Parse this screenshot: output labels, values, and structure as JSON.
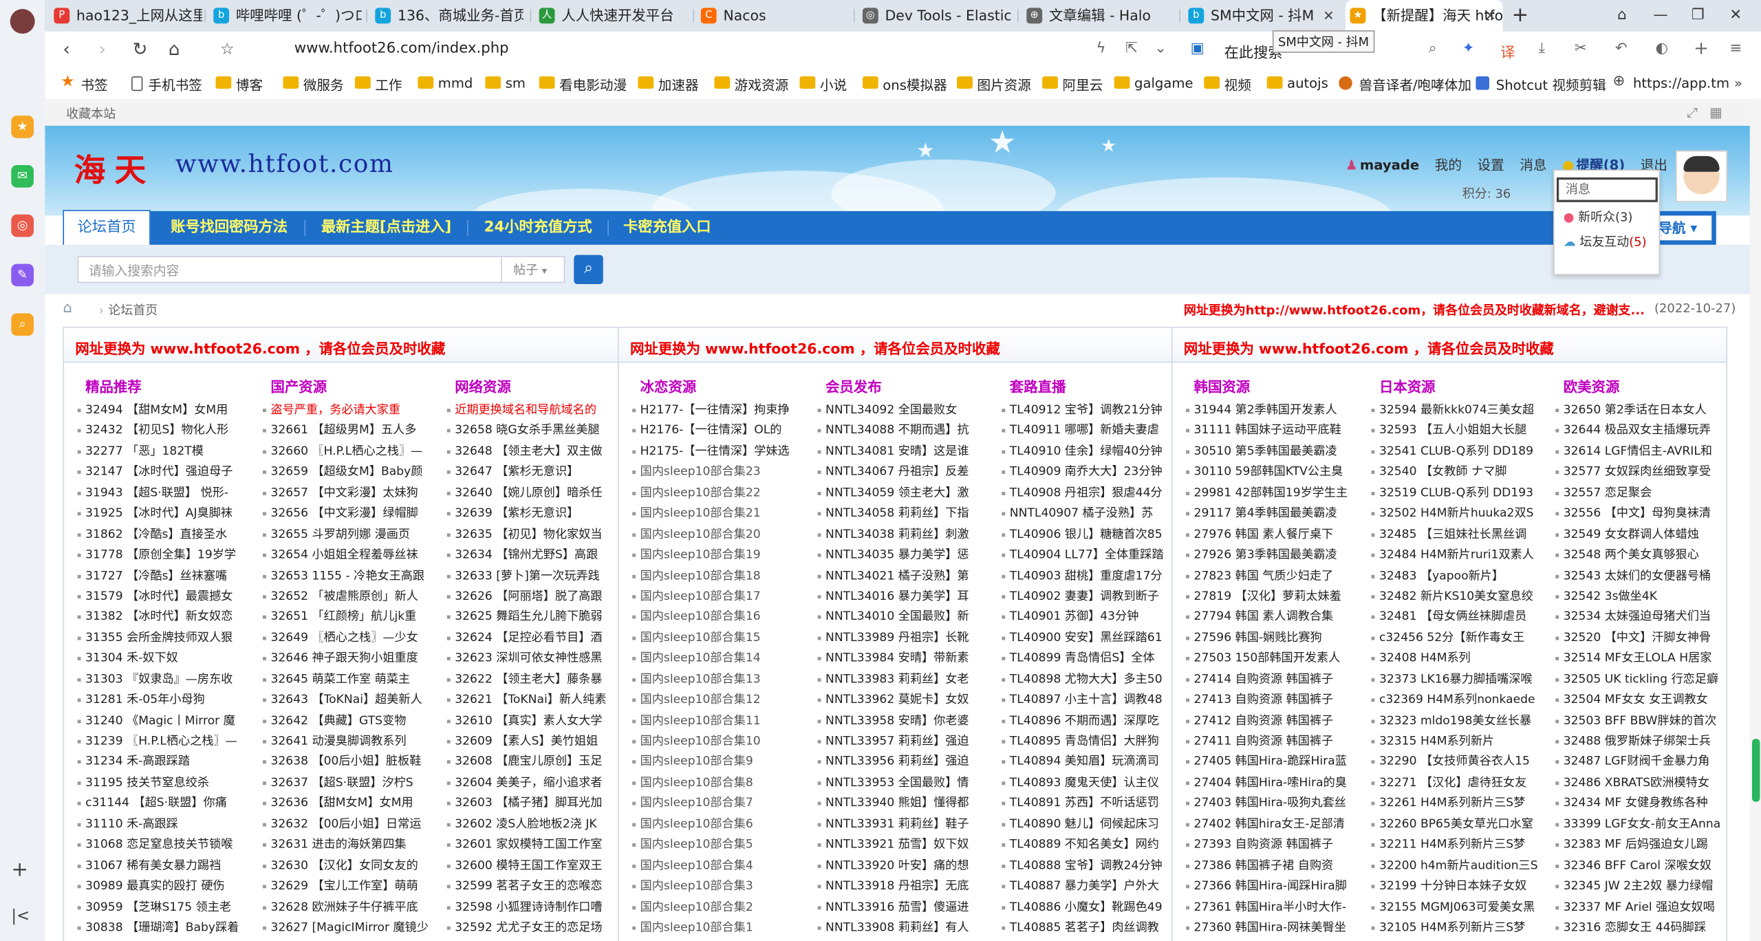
{
  "browser": {
    "tabs": [
      {
        "label": "hao123_上网从这里",
        "icon": "P",
        "color": "#e53935"
      },
      {
        "label": "哔哩哔哩 (゜-゜)つロ",
        "icon": "b",
        "color": "#13a4de"
      },
      {
        "label": "136、商城业务-首页",
        "icon": "b",
        "color": "#13a4de"
      },
      {
        "label": "人人快速开发平台",
        "icon": "人",
        "color": "#2b9a3f"
      },
      {
        "label": "Nacos",
        "icon": "C",
        "color": "#ff6a00"
      },
      {
        "label": "Dev Tools - Elastic",
        "icon": "◎",
        "color": "#555"
      },
      {
        "label": "文章编辑 - Halo",
        "icon": "⊕",
        "color": "#555"
      },
      {
        "label": "SM中文网 - 抖M",
        "icon": "b",
        "color": "#13a4de"
      },
      {
        "label": "【新提醒】海天 htfo",
        "icon": "★",
        "color": "#f0a000"
      }
    ],
    "new_tab_label": "+",
    "url": "www.htfoot26.com/index.php",
    "tooltip": "SM中文网 - 抖M",
    "search_placeholder": "在此搜索",
    "bookmarks": [
      {
        "label": "书签",
        "type": "star"
      },
      {
        "label": "手机书签",
        "type": "doc"
      },
      {
        "label": "博客",
        "type": "folder"
      },
      {
        "label": "微服务",
        "type": "folder"
      },
      {
        "label": "工作",
        "type": "folder"
      },
      {
        "label": "mmd",
        "type": "folder"
      },
      {
        "label": "sm",
        "type": "folder"
      },
      {
        "label": "看电影动漫",
        "type": "folder"
      },
      {
        "label": "加速器",
        "type": "folder"
      },
      {
        "label": "游戏资源",
        "type": "folder"
      },
      {
        "label": "小说",
        "type": "folder"
      },
      {
        "label": "ons模拟器",
        "type": "folder"
      },
      {
        "label": "图片资源",
        "type": "folder"
      },
      {
        "label": "阿里云",
        "type": "folder"
      },
      {
        "label": "galgame",
        "type": "folder"
      },
      {
        "label": "视频",
        "type": "folder"
      },
      {
        "label": "autojs",
        "type": "folder"
      },
      {
        "label": "兽音译者/咆哮体加",
        "type": "ico"
      },
      {
        "label": "Shotcut 视频剪辑",
        "type": "ico"
      },
      {
        "label": "https://app.tm",
        "type": "glob"
      }
    ]
  },
  "site": {
    "collect_label": "收藏本站",
    "logo_cn": "海天",
    "logo_en": "www.htfoot.com",
    "user": {
      "name": "mayade",
      "mine": "我的",
      "settings": "设置",
      "messages": "消息",
      "remind": "提醒(8)",
      "logout": "退出",
      "points": "积分: 36"
    },
    "notif": {
      "msg": "消息",
      "listen": "新听众",
      "listen_count": "(3)",
      "interact": "坛友互动",
      "interact_count": "(5)"
    },
    "nav": {
      "items": [
        "论坛首页",
        "账号找回密码方法",
        "最新主题[点击进入]",
        "24小时充值方式",
        "卡密充值入口"
      ],
      "right": "导航"
    },
    "search": {
      "placeholder": "请输入搜索内容",
      "scope": "帖子"
    },
    "breadcrumb": "论坛首页",
    "announce": "网址更换为http://www.htfoot26.com，请各位会员及时收藏新域名，避谢支...",
    "announce_date": "(2022-10-27)"
  },
  "columns": [
    {
      "header": "网址更换为 www.htfoot26.com ，请各位会员及时收藏",
      "subs": [
        {
          "title": "精品推荐",
          "title_red": false,
          "items": [
            "32494 【甜M女M】女M用",
            "32432 【初见S】物化人形",
            "32277 「恶」182T模",
            "32147 【冰时代】强迫母子",
            "31943 【超S·联盟】 悦形-",
            "31925 【冰时代】AJ臭脚袜",
            "31862 【冷酷s】直接圣水",
            "31778 【原创全集】19岁学",
            "31727 【冷酷s】丝袜塞嘴",
            "31579 【冰时代】最震撼女",
            "31382 【冰时代】新女奴恋",
            "31355 会所金牌技师双人狠",
            "31304 禾-奴下奴",
            "31303 『奴隶岛』—房东收",
            "31281 禾-05年小母狗",
            "31240 《Magic丨Mirror 魔",
            "31239 〖H.P.L栖心之栈〗—",
            "31234 禾-高跟踩踏",
            "31195 技关节窒息绞杀",
            "c31144 【超S·联盟】你痛",
            "31110 禾-高跟踩",
            "31068 恋足窒息技关节锁喉",
            "31067 稀有美女暴力踢裆",
            "30989 最真实的殴打 硬伤",
            "30959 【芝琳S175 领主老",
            "30838 【珊瑚湾】Baby踩着"
          ]
        },
        {
          "title": "国产资源",
          "title_red": false,
          "items": [
            "盗号严重，务必请大家重",
            "32661 【超级男M】五人多",
            "32660 〖H.P.L栖心之栈〗—",
            "32659 【超级女M】Baby颜",
            "32657 【中文彩漫】太妹狗",
            "32656 【中文彩漫】绿帽脚",
            "32655 斗罗胡列娜 漫画页",
            "32654 小姐姐全程羞辱丝袜",
            "32653 1155 - 冷艳女王高跟",
            "32652 「被虐熊原创」新人",
            "32651 「红颜榜」航儿jk重",
            "32649 〖栖心之栈〗—少女",
            "32646 神子跟天狗小姐重度",
            "32645 萌菜工作室 萌菜主",
            "32643 【ToKNai】超美新人",
            "32642 【典藏】GTS变物",
            "32641 动漫臭脚调教系列",
            "32638 【00后小姐】脏板鞋",
            "32637 【超S·联盟】汐柠S",
            "32636 【甜M女M】女M用",
            "32632 【00后小姐】日常运",
            "32631 进击的海妖第四集",
            "32630 【汉化】女同女友的",
            "32629 【宝儿工作室】萌萌",
            "32628 欧洲妹子牛仔裤平底",
            "32627 [MagicIMirror 魔镜少"
          ]
        },
        {
          "title": "网络资源",
          "title_red": false,
          "items": [
            "近期更换域名和导航域名的",
            "32658 晓G女杀手黑丝美腿",
            "32648 【领主老大】双主做",
            "32647 【紫杉无意识】",
            "32640 【婉儿原创】暗杀任",
            "32639 【紫杉无意识】",
            "32635 【初见】物化家奴当",
            "32634 【锦州尤野S】高跟",
            "32633 [萝卜]第一次玩弄践",
            "32626 【阿丽塔】脱了高跟",
            "32625 舞蹈生允儿胯下脆弱",
            "32624 【足控必看节目】酒",
            "32623 深圳可依女神性感黑",
            "32622 【领主老大】藤条暴",
            "32621 【ToKNai】新人纯素",
            "32610 【真实】素人女大学",
            "32609 【素人S】美竹姐姐",
            "32608 【鹿宝儿原创】玉足",
            "32604 美美子，缩小追求者",
            "32603 【橘子猪】脚耳光加",
            "32602 凌S人脸地板2浇 JK",
            "32601 家奴模特工国工作室",
            "32600 模特王国工作室双王",
            "32599 茗茗子女王的恋喉恋",
            "32598 小狐狸诗诗制作口嘈",
            "32592 尤尤子女王的恋足场"
          ]
        }
      ]
    },
    {
      "header": "网址更换为 www.htfoot26.com ，请各位会员及时收藏",
      "subs": [
        {
          "title": "冰恋资源",
          "title_red": false,
          "items": [
            "H2177-【一往情深】拘束挣",
            "H2176-【一往情深】OL的",
            "H2175-【一往情深】学妹选",
            "国内sleep10部合集23",
            "国内sleep10部合集22",
            "国内sleep10部合集21",
            "国内sleep10部合集20",
            "国内sleep10部合集19",
            "国内sleep10部合集18",
            "国内sleep10部合集17",
            "国内sleep10部合集16",
            "国内sleep10部合集15",
            "国内sleep10部合集14",
            "国内sleep10部合集13",
            "国内sleep10部合集12",
            "国内sleep10部合集11",
            "国内sleep10部合集10",
            "国内sleep10部合集9",
            "国内sleep10部合集8",
            "国内sleep10部合集7",
            "国内sleep10部合集6",
            "国内sleep10部合集5",
            "国内sleep10部合集4",
            "国内sleep10部合集3",
            "国内sleep10部合集2",
            "国内sleep10部合集1"
          ]
        },
        {
          "title": "会员发布",
          "title_red": false,
          "items": [
            "NNTL34092 全国最败女",
            "NNTL34088 不期而遇】抗",
            "NNTL34081 安晴】这是谁",
            "NNTL34067 丹祖宗】反差",
            "NNTL34059 领主老大】激",
            "NNTL34058 莉莉丝】下指",
            "NNTL34038 莉莉丝】刺激",
            "NNTL34035 暴力美学】惩",
            "NNTL34021 橘子没熟】第",
            "NNTL34016 暴力美学】耳",
            "NNTL34010 全国最败】新",
            "NNTL33989 丹祖宗】长靴",
            "NNTL33984 安晴】带新素",
            "NNTL33983 莉莉丝】女老",
            "NNTL33962 莫妮卡】女奴",
            "NNTL33958 安晴】你老婆",
            "NNTL33957 莉莉丝】强迫",
            "NNTL33956 莉莉丝】强迫",
            "NNTL33953 全国最败】情",
            "NNTL33940 熊姐】懂得都",
            "NNTL33931 莉莉丝】鞋子",
            "NNTL33921 茄雪】奴下奴",
            "NNTL33920 叶安】痛的想",
            "NNTL33918 丹祖宗】无底",
            "NNTL33916 茄雪】傻逼进",
            "NNTL33908 莉莉丝】有人"
          ]
        },
        {
          "title": "套路直播",
          "title_red": false,
          "items": [
            "TL40912 宝爷】调教21分钟",
            "TL40911 哪哪】新婚夫妻虐",
            "TL40910 佳余】绿帽40分钟",
            "TL40909 南乔大大】23分钟",
            "TL40908 丹祖宗】狠虐44分",
            "NNTL40907 橘子没熟】苏",
            "TL40906 银儿】糖糖首次85",
            "TL40904 LL77】全体重踩踏",
            "TL40903 甜桃】重度虐17分",
            "TL40902 妻妻】调教到断子",
            "TL40901 苏御】43分钟",
            "TL40900 安安】黑丝踩踏61",
            "TL40899 青岛情侣S】全体",
            "TL40898 尤物大大】多主50",
            "TL40897 小主十言】调教48",
            "TL40896 不期而遇】深厚吃",
            "TL40895 青岛情侣】大胖狗",
            "TL40894 美知眉】玩滴滴司",
            "TL40893 魔鬼天使】认主仪",
            "TL40891 苏西】不听话惩罚",
            "TL40890 魅儿】伺候起床习",
            "TL40889 不知名美女】网约",
            "TL40888 宝爷】调教24分钟",
            "TL40887 暴力美学】户外大",
            "TL40886 小魔女】靴踢色49",
            "TL40885 茗茗子】肉丝调教"
          ]
        }
      ]
    },
    {
      "header": "网址更换为 www.htfoot26.com ，请各位会员及时收藏",
      "subs": [
        {
          "title": "韩国资源",
          "title_red": false,
          "items": [
            "31944 第2季韩国开发素人",
            "31111 韩国妹子运动平底鞋",
            "30510 第5季韩国最美霸凌",
            "30110 59部韩国KTV公主臭",
            "29981 42部韩国19岁学生主",
            "29117 第4季韩国最美霸凌",
            "27976 韩国 素人餐厅桌下",
            "27926 第3季韩国最美霸凌",
            "27823 韩国 气质少妇走了",
            "27819 【汉化】萝莉太妹羞",
            "27794 韩国 素人调教合集",
            "27596 韩国-娴贱比赛狗",
            "27503 150部韩国开发素人",
            "27414 自购资源 韩国裤子",
            "27413 自购资源 韩国裤子",
            "27412 自购资源 韩国裤子",
            "27411 自购资源 韩国裤子",
            "27405 韩国Hira-跪踩Hira蓝",
            "27404 韩国Hira-嗦Hira的臭",
            "27403 韩国Hira-吸狗丸套丝",
            "27402 韩国hira女王-足部清",
            "27393 自购资源 韩国裤子",
            "27386 韩国裤子裙 自购资",
            "27366 韩国Hira-闻踩Hira脚",
            "27361 韩国Hira半小时大作-",
            "27360 韩国Hira-网袜美臀坐"
          ]
        },
        {
          "title": "日本资源",
          "title_red": false,
          "items": [
            "32594 最新kkk074三美女超",
            "32593 【五人小姐姐大长腿",
            "32541 CLUB-Q系列 DD189",
            "32540 【女教師 ナマ脚",
            "32519 CLUB-Q系列 DD193",
            "32502 H4M新片huuka2双S",
            "32485 【三姐妹社长黑丝调",
            "32484 H4M新片ruri1双素人",
            "32483 【yapoo新片】",
            "32482 新片KS10美女窒息绞",
            "32481 【母女俩丝袜脚虐员",
            "c32456 52分【新作毒女王",
            "32408 H4M系列",
            "32373 LK16暴力脚插嘴深喉",
            "c32369 H4M系列nonkaede",
            "32323 mldo198美女丝长暴",
            "32315 H4M系列新片",
            "32290 【女技师黄谷衣人15",
            "32271 【汉化】虐待狂女友",
            "32261 H4M系列新片三S梦",
            "32260 BP65美女草光口水窒",
            "32211 H4M系列新片三S梦",
            "32200 h4m新片audition三S",
            "32199 十分钟日本妹子女奴",
            "32155 MGMJ063可爱美女黑",
            "32105 H4M系列新片三S梦"
          ]
        },
        {
          "title": "欧美资源",
          "title_red": false,
          "items": [
            "32650 第2季话在日本女人",
            "32644 极品双女主插爆玩弄",
            "32614 LGF情侣主-AVRIL和",
            "32577 女奴踩肉丝细致享受",
            "32557 恋足聚会",
            "32556 【中文】母狗臭袜清",
            "32549 女女群调人体蜡烛",
            "32548 两个美女真够狠心",
            "32543 太妹们的女便器号桶",
            "32542 3s做坐4K",
            "32534 太妹强迫母猪犬们当",
            "32520 【中文】汗脚女神骨",
            "32514 MF女王LOLA Η居家",
            "32505 UK tickling 行恋足癖",
            "32504 MF女女 女王调教女",
            "32503 BFF BBW胖妹的首次",
            "32488 俄罗斯妹子绑架士兵",
            "32487 LGF财阀千金暴力角",
            "32486 XBRATS欧洲模特女",
            "32434 MF 女健身教练各种",
            "33399 LGF女女-前女王Anna",
            "32383 MF 后妈强迫女儿踢",
            "32346 BFF Carol 深喉女奴",
            "32345 JW 2主2奴 暴力绿帽",
            "32337 MF Ariel 强迫女奴喝",
            "32316 恋脚女王 44码脚踩"
          ]
        }
      ]
    }
  ]
}
